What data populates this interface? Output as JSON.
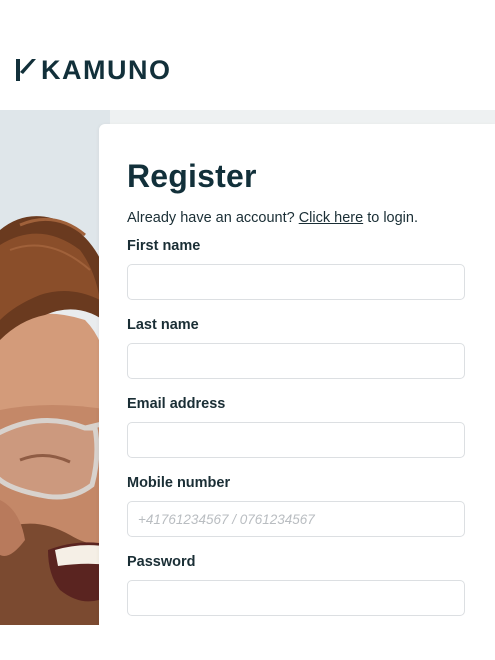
{
  "brand": {
    "name": "KAMUNO",
    "color": "#12303a"
  },
  "form": {
    "title": "Register",
    "subtitle_prefix": "Already have an account? ",
    "subtitle_link": "Click here",
    "subtitle_suffix": " to login.",
    "fields": [
      {
        "label": "First name",
        "value": "",
        "placeholder": ""
      },
      {
        "label": "Last name",
        "value": "",
        "placeholder": ""
      },
      {
        "label": "Email address",
        "value": "",
        "placeholder": ""
      },
      {
        "label": "Mobile number",
        "value": "",
        "placeholder": "+41761234567 / 0761234567"
      },
      {
        "label": "Password",
        "value": "",
        "placeholder": ""
      }
    ]
  }
}
